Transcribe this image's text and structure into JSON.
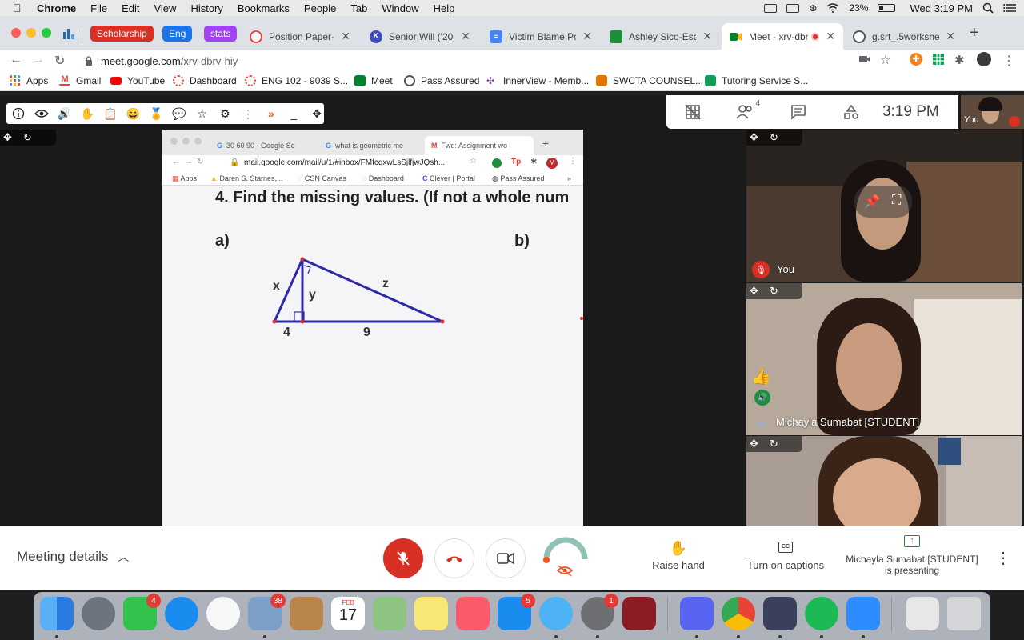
{
  "menubar": {
    "app": "Chrome",
    "items": [
      "File",
      "Edit",
      "View",
      "History",
      "Bookmarks",
      "People",
      "Tab",
      "Window",
      "Help"
    ],
    "battery": "23%",
    "clock": "Wed 3:19 PM"
  },
  "tabs": {
    "groups": [
      {
        "label": "Scholarship",
        "color": "#d93025"
      },
      {
        "label": "Eng",
        "color": "#1a73e8"
      },
      {
        "label": "stats",
        "color": "#a142f4"
      }
    ],
    "items": [
      {
        "title": "Position Paper- Fir"
      },
      {
        "title": "Senior Will ('20).p"
      },
      {
        "title": "Victim Blame Posit"
      },
      {
        "title": "Ashley Sico-Esqui"
      },
      {
        "title": "Meet - xrv-dbr",
        "active": true
      },
      {
        "title": "g.srt_.5worksheet"
      }
    ]
  },
  "omnibox": {
    "url_host": "meet.google.com",
    "url_path": "/xrv-dbrv-hiy"
  },
  "bookmarks": [
    "Apps",
    "Gmail",
    "YouTube",
    "Dashboard",
    "ENG 102 - 9039 S...",
    "Meet",
    "Pass Assured",
    "InnerView - Memb...",
    "SWCTA COUNSEL...",
    "Tutoring Service S..."
  ],
  "meet_top": {
    "people_count": "4",
    "time": "3:19 PM",
    "self_label": "You"
  },
  "shared_screen": {
    "tabs": [
      "30 60 90 - Google Se",
      "what is geometric me",
      "Fwd: Assignment wo"
    ],
    "address": "mail.google.com/mail/u/1/#inbox/FMfcgxwLsSjlfjwJQsh...",
    "profile_initial": "M",
    "bookmarks": [
      "Apps",
      "Daren S. Starnes,...",
      "CSN Canvas",
      "Dashboard",
      "Clever | Portal",
      "Pass Assured"
    ],
    "question": "4. Find the missing values. (If not a whole num",
    "part_a": "a)",
    "part_b": "b)",
    "labels": {
      "x": "x",
      "y": "y",
      "z": "z",
      "left_seg": "4",
      "right_seg": "9"
    }
  },
  "participants": [
    {
      "name": "You"
    },
    {
      "name": "Michayla Sumabat [STUDENT]"
    },
    {
      "name": ""
    }
  ],
  "bottom": {
    "meeting_details": "Meeting details",
    "raise_hand": "Raise hand",
    "captions": "Turn on captions",
    "presenting_line1": "Michayla Sumabat [STUDENT]",
    "presenting_line2": "is presenting"
  },
  "dock_badges": {
    "facetime": "4",
    "preview": "38",
    "appstore": "5",
    "prefs": "1"
  },
  "calendar": {
    "month": "FEB",
    "day": "17"
  },
  "colors": {
    "meet_red": "#d93025",
    "accent_green": "#1e8e3e",
    "triangle_blue": "#2d2aa8"
  }
}
